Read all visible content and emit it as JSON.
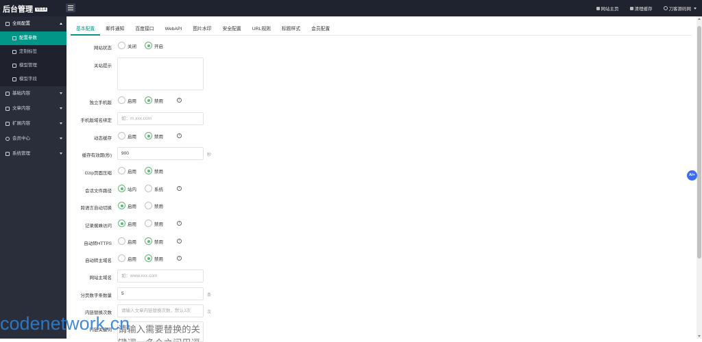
{
  "header": {
    "logo": "后台管理",
    "version": "V3.1.4",
    "nav": [
      {
        "label": "网站主页",
        "icon": "home-icon"
      },
      {
        "label": "清理缓存",
        "icon": "trash-icon"
      },
      {
        "label": "刀客源码网",
        "icon": "user-icon"
      }
    ]
  },
  "sidebar": {
    "groups": [
      {
        "label": "全局配置",
        "icon": "settings-icon",
        "open": true,
        "items": [
          {
            "label": "配置参数",
            "icon": "sliders-icon",
            "active": true
          },
          {
            "label": "定制标签",
            "icon": "wrench-icon"
          },
          {
            "label": "模型管理",
            "icon": "globe-icon"
          },
          {
            "label": "模型字段",
            "icon": "external-link-icon"
          }
        ]
      },
      {
        "label": "基础内容",
        "icon": "sliders-icon"
      },
      {
        "label": "文章内容",
        "icon": "document-icon"
      },
      {
        "label": "扩展内容",
        "icon": "expand-icon"
      },
      {
        "label": "会员中心",
        "icon": "user-icon"
      },
      {
        "label": "系统管理",
        "icon": "gear-icon"
      }
    ]
  },
  "tabs": [
    "基本配置",
    "邮件通知",
    "百度接口",
    "WebAPI",
    "图片水印",
    "安全配置",
    "URL规则",
    "标题样式",
    "会员配置"
  ],
  "form": {
    "site_status": {
      "label": "网站状态",
      "options": [
        "关闭",
        "开启"
      ],
      "selected": 1
    },
    "close_tip": {
      "label": "关站提示"
    },
    "mobile_site": {
      "label": "独立手机版",
      "options": [
        "启用",
        "禁用"
      ],
      "selected": 1
    },
    "mobile_domain": {
      "label": "手机版域名绑定",
      "placeholder": "如：m.xxx.com"
    },
    "dynamic_cache": {
      "label": "动态缓存",
      "options": [
        "启用",
        "禁用"
      ],
      "selected": 1
    },
    "cache_ttl": {
      "label": "缓存有效期(秒)",
      "value": "900",
      "unit": "秒"
    },
    "gzip": {
      "label": "Gzip页面压缩",
      "options": [
        "启用",
        "禁用"
      ],
      "selected": 1
    },
    "session_path": {
      "label": "会话文件路径",
      "options": [
        "站内",
        "系统"
      ],
      "selected": 0
    },
    "lang_switch": {
      "label": "跨语言自动切换",
      "options": [
        "启用",
        "禁用"
      ],
      "selected": 0
    },
    "spider_log": {
      "label": "记录蜘蛛访问",
      "options": [
        "启用",
        "禁用"
      ],
      "selected": 0
    },
    "https": {
      "label": "自动转HTTPS",
      "options": [
        "启用",
        "禁用"
      ],
      "selected": 1
    },
    "main_domain_redirect": {
      "label": "自动转主域名",
      "options": [
        "启用",
        "禁用"
      ],
      "selected": 1
    },
    "main_domain": {
      "label": "网站主域名",
      "placeholder": "如：www.xxx.com"
    },
    "page_count": {
      "label": "分页数字条数量",
      "value": "5",
      "unit": "条"
    },
    "link_replace": {
      "label": "内链替换次数",
      "placeholder": "请输入文章内链替换次数，默认3次",
      "unit": "次"
    },
    "keywords": {
      "label": "内链关键词",
      "placeholder": "请输入需要替换的关键词，多个之间用逗号隔开"
    }
  },
  "ai_button": "AI+",
  "watermark": "codenetwork.cn"
}
